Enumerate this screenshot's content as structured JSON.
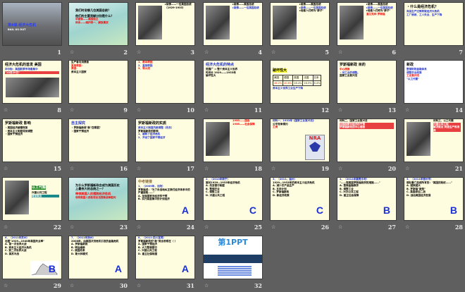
{
  "view": "slide-sorter",
  "slides": [
    {
      "n": "1",
      "anim": false,
      "bg": "photo",
      "title": "第4课 经济大危机",
      "title_color": "#2a3fff",
      "lines": [
        {
          "t": "BAIL US OUT",
          "c": "#ffffff"
        }
      ],
      "img": "none"
    },
    {
      "n": "2",
      "anim": true,
      "bg": "grad",
      "title": "",
      "lines": [
        {
          "t": "我们时说哪几位美国总统？",
          "c": "#000"
        },
        {
          "t": "他们的主要贡献分别是什么？",
          "c": "#000"
        },
        {
          "t": "华盛顿——美国独立",
          "c": "#ff0000"
        },
        {
          "t": "林肯——维护统一、解放黑奴",
          "c": "#ff0000"
        }
      ],
      "img": "none"
    },
    {
      "n": "3",
      "anim": true,
      "bg": "yellow",
      "title": "",
      "lines": [
        {
          "t": "▸胡佛——一位美国总统（1929-1933）",
          "c": "#000"
        }
      ],
      "img": "left"
    },
    {
      "n": "4",
      "anim": true,
      "bg": "yellow",
      "title": "",
      "lines": [
        {
          "t": "▸胡佛——美国总统",
          "c": "#000"
        },
        {
          "t": "▸胡佛——一位美国总统",
          "c": "#2233cc"
        }
      ],
      "img": "left"
    },
    {
      "n": "5",
      "anim": true,
      "bg": "yellow",
      "title": "",
      "lines": [
        {
          "t": "▸胡佛——美国总统",
          "c": "#000"
        },
        {
          "t": "▸胡佛——一位美国总统",
          "c": "#2233cc"
        },
        {
          "t": "▸他被人们称为\"胖子\"",
          "c": "#000"
        }
      ],
      "img": "left"
    },
    {
      "n": "6",
      "anim": true,
      "bg": "yellow",
      "title": "",
      "lines": [
        {
          "t": "▸胡佛——美国总统",
          "c": "#000"
        },
        {
          "t": "▸胡佛——一位美国总统",
          "c": "#2233cc"
        },
        {
          "t": "▸他被人们称为\"胖子\"",
          "c": "#000"
        },
        {
          "t": "富兰克林·罗斯福",
          "c": "#ff0000"
        }
      ],
      "img": "left"
    },
    {
      "n": "7",
      "anim": false,
      "bg": "yellow",
      "title": "・什么是经济危机？",
      "title_color": "#000",
      "lines": [
        {
          "t": "商品生产过剩导致经济大危机",
          "c": "#2233cc"
        },
        {
          "t": "工厂倒闭、工人失业、生产下降",
          "c": "#2233cc"
        }
      ],
      "img": "none"
    },
    {
      "n": "8",
      "anim": true,
      "bg": "yellow",
      "title": "经济大危机的首发 美国",
      "title_color": "#000",
      "lines": [
        {
          "t": "华尔街：美国股票市场最集中",
          "c": "#2233cc"
        },
        {
          "t": "\"10月29日\"",
          "c": "#ffffff"
        }
      ],
      "img": "bottom"
    },
    {
      "n": "9",
      "anim": true,
      "bg": "yellow",
      "title": "",
      "lines": [
        {
          "t": "生产者与消费者",
          "c": "#000"
        },
        {
          "t": "直接原因：",
          "c": "#ff0000"
        },
        {
          "t": "原因：",
          "c": "#ff0000"
        },
        {
          "t": "资本主义国家",
          "c": "#000"
        }
      ],
      "img": "none"
    },
    {
      "n": "10",
      "anim": true,
      "bg": "yellow",
      "title": "",
      "lines": [
        {
          "t": "1、根本原因",
          "c": "#ff0000"
        },
        {
          "t": "2、直接原因",
          "c": "#2233cc"
        },
        {
          "t": "3、导火线",
          "c": "#ff0000"
        }
      ],
      "img": "none"
    },
    {
      "n": "11",
      "anim": true,
      "bg": "yellow",
      "title": "经济大危机的特点",
      "title_color": "#2233cc",
      "lines": [
        {
          "t": "范围广 ⇒ 整个资本主义世界",
          "c": "#000"
        },
        {
          "t": "时间长 1929——1933年",
          "c": "#000"
        },
        {
          "t": "破坏性大",
          "c": "#000"
        }
      ],
      "img": "none"
    },
    {
      "n": "12",
      "anim": false,
      "bg": "yellow",
      "title": "破坏性大",
      "title_color": "#000",
      "table": {
        "head": [
          "美国",
          "德国",
          "英国",
          "法国",
          "日本"
        ],
        "vals": [
          "46.2%",
          "40.6%",
          "28.4%",
          "16.5%",
          "8.4%"
        ]
      },
      "lines": [
        {
          "t": "资本主义世界工业生产下降",
          "c": "#2233cc"
        }
      ],
      "img": "none"
    },
    {
      "n": "13",
      "anim": true,
      "bg": "yellow",
      "title": "罗斯福新政 目的",
      "title_color": "#000",
      "lines": [
        {
          "t": "中心措施",
          "c": "#ff0000"
        },
        {
          "t": "・对工业的调整。",
          "c": "#2233cc"
        },
        {
          "t": "国家工业复兴法",
          "c": "#000"
        }
      ],
      "img": "none"
    },
    {
      "n": "14",
      "anim": true,
      "bg": "white",
      "title": "新政",
      "title_color": "#000",
      "lines": [
        {
          "t": "整顿财政金融体系",
          "c": "#2233cc"
        },
        {
          "t": "调整农业政策",
          "c": "#2233cc"
        },
        {
          "t": "工业复兴法",
          "c": "#ff0000"
        },
        {
          "t": "\"以工代赈\"",
          "c": "#2233cc"
        }
      ],
      "img": "none"
    },
    {
      "n": "15",
      "anim": true,
      "bg": "yellow",
      "title": "罗斯福新政 影响",
      "title_color": "#000",
      "lines": [
        {
          "t": "・美国经济缓慢恢复",
          "c": "#000"
        },
        {
          "t": "・资本主义制度得到调整",
          "c": "#000"
        },
        {
          "t": "・国家干预经济",
          "c": "#000"
        }
      ],
      "img": "none"
    },
    {
      "n": "16",
      "anim": true,
      "bg": "yellow",
      "title": "自主探究",
      "title_color": "#2233cc",
      "lines": [
        {
          "t": "・罗斯福新政\"新\"在哪里？",
          "c": "#000"
        },
        {
          "t": "・国家干预经济",
          "c": "#000"
        }
      ],
      "img": "none"
    },
    {
      "n": "17",
      "anim": true,
      "bg": "yellow",
      "title": "罗斯福新政的实质",
      "title_color": "#000",
      "lines": [
        {
          "t": "资本主义制度内部调整（改良）",
          "c": "#2233cc"
        },
        {
          "t": "罗斯福新政的影响",
          "c": "#000"
        },
        {
          "t": "1、缓和了经济危机",
          "c": "#2233cc"
        },
        {
          "t": "2、开创了国家干预经济",
          "c": "#2233cc"
        }
      ],
      "img": "none"
    },
    {
      "n": "18",
      "anim": true,
      "bg": "yellow",
      "title": "",
      "lines": [
        {
          "t": "1933——国会",
          "c": "#ff0000"
        },
        {
          "t": "1935——社会保障",
          "c": "#ff0000"
        }
      ],
      "img": "left"
    },
    {
      "n": "19",
      "anim": true,
      "bg": "yellow",
      "title": "",
      "lines": [
        {
          "t": "材料一、1933年《国家工业复兴法》",
          "c": "#2233cc"
        },
        {
          "t": "公平竞争规约",
          "c": "#000"
        },
        {
          "t": "工资",
          "c": "#ff0000"
        }
      ],
      "img": "nra"
    },
    {
      "n": "20",
      "anim": true,
      "bg": "yellow",
      "title": "",
      "lines": [
        {
          "t": "材料二、国家工业复兴法",
          "c": "#000"
        },
        {
          "t": "加强国家对经济的干预",
          "c": "#ffffff"
        },
        {
          "t": "罗斯福新政的中心措施",
          "c": "#ffffff"
        }
      ],
      "img": "none"
    },
    {
      "n": "21",
      "anim": true,
      "bg": "yellow",
      "title": "",
      "lines": [
        {
          "t": "材料三、以工代赈",
          "c": "#000"
        },
        {
          "t": "兴建公共工程",
          "c": "#ffffff"
        },
        {
          "t": "解决就业 刺激生产和消费",
          "c": "#ffffff"
        }
      ],
      "img": "left"
    },
    {
      "n": "22",
      "anim": true,
      "bg": "yellow",
      "title": "以工代赈",
      "title_color": "#ffffff",
      "lines": [
        {
          "t": "兴建公共工程",
          "c": "#000"
        },
        {
          "t": "增加就业",
          "c": "#ffffff"
        }
      ],
      "img": "left"
    },
    {
      "n": "23",
      "anim": true,
      "bg": "grad",
      "title": "",
      "lines": [
        {
          "t": "为什么罗斯福新政会成为美国历史上最伟大的总统之一？",
          "c": "#000"
        },
        {
          "t": "带领美国人民摆脱经济危机",
          "c": "#ff0000"
        },
        {
          "t": "领导美国人民取得反法西斯战争胜利",
          "c": "#ff0000"
        }
      ],
      "img": "none"
    },
    {
      "n": "24",
      "anim": true,
      "bg": "yellow",
      "title": "中考链接",
      "title_color": "#8a6a3a",
      "lines": [
        {
          "t": "1、（2009年，沈阳）",
          "c": "#2233cc"
        },
        {
          "t": "罗斯福说：\"为了永远地纠正我们经济体系中的严重缺陷……\"",
          "c": "#000"
        },
        {
          "t": "A. 加强国家对经济的干预",
          "c": "#000"
        },
        {
          "t": "B. 实行高度集中的计划经济",
          "c": "#000"
        }
      ],
      "answer": "A",
      "img": "none"
    },
    {
      "n": "25",
      "anim": true,
      "bg": "yellow",
      "title": "",
      "lines": [
        {
          "t": "2、（2010年南宁）",
          "c": "#2233cc"
        },
        {
          "t": "面对1929—1933年经济危机",
          "c": "#000"
        },
        {
          "t": "A. 改变银行制度",
          "c": "#000"
        },
        {
          "t": "B. 整顿农业",
          "c": "#000"
        },
        {
          "t": "C. 调整工业",
          "c": "#000"
        },
        {
          "t": "D. 兴建公共工程",
          "c": "#000"
        }
      ],
      "answer": "C",
      "img": "none"
    },
    {
      "n": "26",
      "anim": true,
      "bg": "yellow",
      "title": "",
      "lines": [
        {
          "t": "3、（2011，福州）",
          "c": "#2233cc"
        },
        {
          "t": "1929—1933年的资本主义经济危机",
          "c": "#000"
        },
        {
          "t": "A. 减少农产品生产",
          "c": "#000"
        },
        {
          "t": "B. 五年计划",
          "c": "#000"
        },
        {
          "t": "C. 罗斯福新政",
          "c": "#000"
        },
        {
          "t": "D. 新经济政策",
          "c": "#000"
        }
      ],
      "answer": "C",
      "img": "none"
    },
    {
      "n": "27",
      "anim": true,
      "bg": "yellow",
      "title": "",
      "lines": [
        {
          "t": "4、（2011年襄樊中考）",
          "c": "#2233cc"
        },
        {
          "t": "\"……而美国罗斯福政府的措施……\"",
          "c": "#000"
        },
        {
          "t": "A. 整顿金融秩序",
          "c": "#000"
        },
        {
          "t": "B. 调整工业",
          "c": "#000"
        },
        {
          "t": "C. 兴办公共工程",
          "c": "#000"
        },
        {
          "t": "D. 建立社会保障",
          "c": "#000"
        }
      ],
      "answer": "B",
      "img": "none"
    },
    {
      "n": "28",
      "anim": true,
      "bg": "yellow",
      "title": "",
      "lines": [
        {
          "t": "5、（2011年德州市）",
          "c": "#2233cc"
        },
        {
          "t": "德杜鲁门总统所写的：\"美国的政权……\"",
          "c": "#000"
        },
        {
          "t": "A. 越来越大",
          "c": "#000"
        },
        {
          "t": "B. 罗斯福\"新政\"",
          "c": "#000"
        },
        {
          "t": "C. 美国参加二战",
          "c": "#000"
        },
        {
          "t": "D. 战后美国经济发展",
          "c": "#000"
        }
      ],
      "answer": "B",
      "img": "none"
    },
    {
      "n": "29",
      "anim": true,
      "bg": "yellow",
      "title": "",
      "lines": [
        {
          "t": "6、（2011年苏州）",
          "c": "#2233cc"
        },
        {
          "t": "右图\"1929—1940年美国失业率\"",
          "c": "#000"
        },
        {
          "t": "A. 第一次世界大战",
          "c": "#000"
        },
        {
          "t": "B. 资本主义经济大危机",
          "c": "#000"
        },
        {
          "t": "C. 第二次世界大战",
          "c": "#000"
        },
        {
          "t": "D. 美苏冷战",
          "c": "#000"
        }
      ],
      "answer": "B",
      "img": "chart"
    },
    {
      "n": "30",
      "anim": true,
      "bg": "yellow",
      "title": "",
      "lines": [
        {
          "t": "7、（2011年扬州）",
          "c": "#2233cc"
        },
        {
          "t": "2008年，由美国次贷危机引发的金融危机",
          "c": "#000"
        },
        {
          "t": "A. 罗斯福新政",
          "c": "#000"
        },
        {
          "t": "B. 明治维新",
          "c": "#000"
        },
        {
          "t": "C. 俄国改革",
          "c": "#000"
        },
        {
          "t": "D. 斯大林模式",
          "c": "#000"
        }
      ],
      "answer": "A",
      "img": "none"
    },
    {
      "n": "31",
      "anim": true,
      "bg": "yellow",
      "title": "",
      "lines": [
        {
          "t": "8、（2011·四川宜宾）",
          "c": "#2233cc"
        },
        {
          "t": "罗斯福新政的\"新\"突出表现在（ ）",
          "c": "#000"
        },
        {
          "t": "A. 国家干预经济",
          "c": "#000"
        },
        {
          "t": "B. 大力整顿银行",
          "c": "#000"
        },
        {
          "t": "C. 兴建公共工程",
          "c": "#000"
        },
        {
          "t": "D. 建立社保制度",
          "c": "#000"
        }
      ],
      "answer": "A",
      "img": "none"
    },
    {
      "n": "32",
      "anim": true,
      "bg": "white",
      "title": "第1PPT",
      "title_color": "#2a8ad8",
      "lines": [],
      "img": "banner"
    }
  ]
}
